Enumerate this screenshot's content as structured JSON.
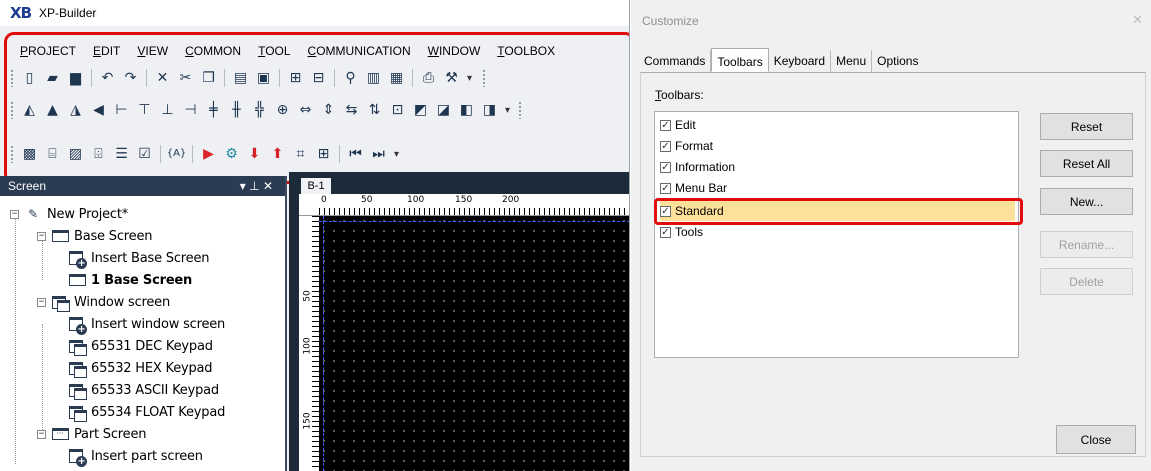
{
  "app": {
    "logo_text": "XB",
    "title": "XP-Builder"
  },
  "menu": [
    "PROJECT",
    "EDIT",
    "VIEW",
    "COMMON",
    "TOOL",
    "COMMUNICATION",
    "WINDOW",
    "TOOLBOX"
  ],
  "screen_panel": {
    "title": "Screen",
    "pin_glyph": "▾ ⊥ ✕",
    "tree": [
      {
        "label": "New Project*"
      },
      {
        "label": "Base Screen"
      },
      {
        "label": "Insert Base Screen"
      },
      {
        "label": "1 Base Screen"
      },
      {
        "label": "Window screen"
      },
      {
        "label": "Insert window screen"
      },
      {
        "label": "65531 DEC Keypad"
      },
      {
        "label": "65532 HEX Keypad"
      },
      {
        "label": "65533 ASCII Keypad"
      },
      {
        "label": "65534 FLOAT Keypad"
      },
      {
        "label": "Part Screen"
      },
      {
        "label": "Insert part screen"
      }
    ]
  },
  "canvas": {
    "tab": "B-1",
    "ruler_top": [
      "0",
      "50",
      "100",
      "150",
      "200"
    ],
    "ruler_left": [
      "50",
      "100",
      "150"
    ]
  },
  "dialog": {
    "title": "Customize",
    "close_glyph": "✕",
    "tabs": [
      "Commands",
      "Toolbars",
      "Keyboard",
      "Menu",
      "Options"
    ],
    "active_tab": "Toolbars",
    "list_label": "Toolbars:",
    "toolbars": [
      {
        "name": "Edit",
        "checked": true
      },
      {
        "name": "Format",
        "checked": true
      },
      {
        "name": "Information",
        "checked": true
      },
      {
        "name": "Menu Bar",
        "checked": true
      },
      {
        "name": "Standard",
        "checked": true,
        "selected": true
      },
      {
        "name": "Tools",
        "checked": true
      }
    ],
    "buttons": {
      "reset": "Reset",
      "reset_all": "Reset All",
      "new": "New...",
      "rename": "Rename...",
      "delete": "Delete",
      "close": "Close"
    }
  },
  "colors": {
    "highlight_red": "#e10d0d",
    "selection_yellow": "#fde09a",
    "panel_header": "#2b3c52"
  }
}
